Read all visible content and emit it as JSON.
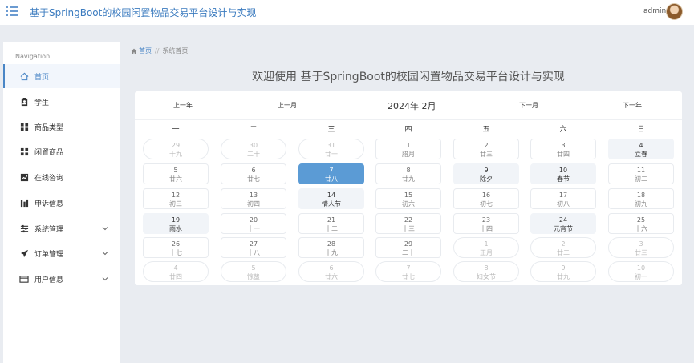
{
  "header": {
    "title": "基于SpringBoot的校园闲置物品交易平台设计与实现",
    "user": "admin"
  },
  "sidebar": {
    "nav_title": "Navigation",
    "items": [
      {
        "label": "首页",
        "icon": "home-icon",
        "active": true
      },
      {
        "label": "学生",
        "icon": "user-badge-icon"
      },
      {
        "label": "商品类型",
        "icon": "grid-icon"
      },
      {
        "label": "闲置商品",
        "icon": "grid-icon"
      },
      {
        "label": "在线咨询",
        "icon": "chart-icon"
      },
      {
        "label": "申诉信息",
        "icon": "bar-chart-icon"
      },
      {
        "label": "系统管理",
        "icon": "sliders-icon",
        "expandable": true
      },
      {
        "label": "订单管理",
        "icon": "send-icon",
        "expandable": true
      },
      {
        "label": "用户信息",
        "icon": "card-icon",
        "expandable": true
      }
    ]
  },
  "breadcrumb": {
    "home": "首页",
    "separator": "//",
    "current": "系统首页"
  },
  "welcome": "欢迎使用 基于SpringBoot的校园闲置物品交易平台设计与实现",
  "calendar": {
    "prev_year": "上一年",
    "prev_month": "上一月",
    "current_month": "2024年 2月",
    "next_month": "下一月",
    "next_year": "下一年",
    "weekdays": [
      "一",
      "二",
      "三",
      "四",
      "五",
      "六",
      "日"
    ],
    "weeks": [
      [
        {
          "d": "29",
          "l": "十九",
          "other": true
        },
        {
          "d": "30",
          "l": "二十",
          "other": true
        },
        {
          "d": "31",
          "l": "廿一",
          "other": true
        },
        {
          "d": "1",
          "l": "腊月"
        },
        {
          "d": "2",
          "l": "廿三"
        },
        {
          "d": "3",
          "l": "廿四"
        },
        {
          "d": "4",
          "l": "立春",
          "holiday": true
        }
      ],
      [
        {
          "d": "5",
          "l": "廿六"
        },
        {
          "d": "6",
          "l": "廿七"
        },
        {
          "d": "7",
          "l": "廿八",
          "today": true
        },
        {
          "d": "8",
          "l": "廿九"
        },
        {
          "d": "9",
          "l": "除夕",
          "holiday": true
        },
        {
          "d": "10",
          "l": "春节",
          "holiday": true
        },
        {
          "d": "11",
          "l": "初二"
        }
      ],
      [
        {
          "d": "12",
          "l": "初三"
        },
        {
          "d": "13",
          "l": "初四"
        },
        {
          "d": "14",
          "l": "情人节",
          "holiday": true
        },
        {
          "d": "15",
          "l": "初六"
        },
        {
          "d": "16",
          "l": "初七"
        },
        {
          "d": "17",
          "l": "初八"
        },
        {
          "d": "18",
          "l": "初九"
        }
      ],
      [
        {
          "d": "19",
          "l": "雨水",
          "holiday": true
        },
        {
          "d": "20",
          "l": "十一"
        },
        {
          "d": "21",
          "l": "十二"
        },
        {
          "d": "22",
          "l": "十三"
        },
        {
          "d": "23",
          "l": "十四"
        },
        {
          "d": "24",
          "l": "元宵节",
          "holiday": true
        },
        {
          "d": "25",
          "l": "十六"
        }
      ],
      [
        {
          "d": "26",
          "l": "十七"
        },
        {
          "d": "27",
          "l": "十八"
        },
        {
          "d": "28",
          "l": "十九"
        },
        {
          "d": "29",
          "l": "二十"
        },
        {
          "d": "1",
          "l": "正月",
          "other": true
        },
        {
          "d": "2",
          "l": "廿二",
          "other": true
        },
        {
          "d": "3",
          "l": "廿三",
          "other": true
        }
      ],
      [
        {
          "d": "4",
          "l": "廿四",
          "other": true
        },
        {
          "d": "5",
          "l": "惊蛰",
          "other": true
        },
        {
          "d": "6",
          "l": "廿六",
          "other": true
        },
        {
          "d": "7",
          "l": "廿七",
          "other": true
        },
        {
          "d": "8",
          "l": "妇女节",
          "other": true
        },
        {
          "d": "9",
          "l": "廿九",
          "other": true
        },
        {
          "d": "10",
          "l": "初一",
          "other": true
        }
      ]
    ]
  },
  "colors": {
    "accent": "#4a86c6",
    "today": "#5b9bd5",
    "background": "#e9ecf1"
  }
}
